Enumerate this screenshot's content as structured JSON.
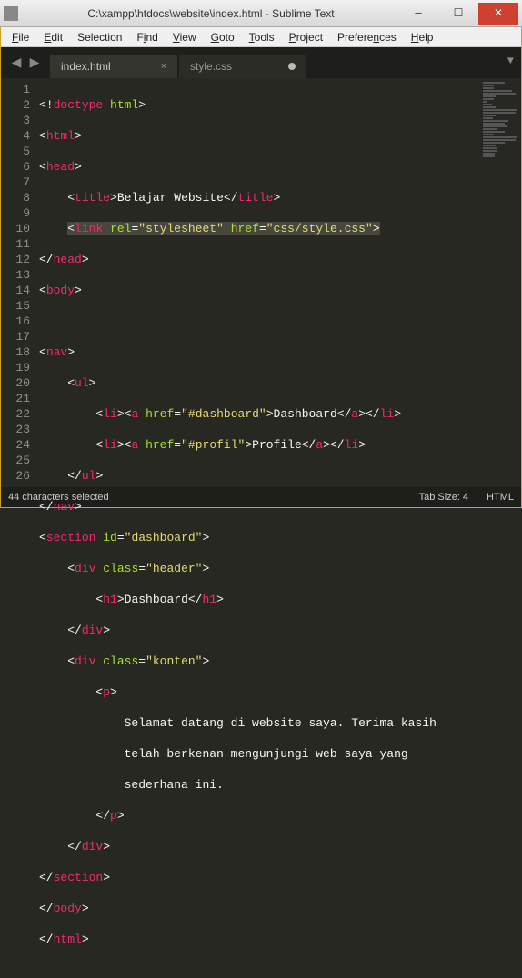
{
  "window": {
    "title": "C:\\xampp\\htdocs\\website\\index.html - Sublime Text"
  },
  "menu": {
    "file": "File",
    "edit": "Edit",
    "selection": "Selection",
    "find": "Find",
    "view": "View",
    "goto": "Goto",
    "tools": "Tools",
    "project": "Project",
    "preferences": "Preferences",
    "help": "Help"
  },
  "tabs": {
    "t0": "index.html",
    "t1": "style.css"
  },
  "gutter": {
    "l1": "1",
    "l2": "2",
    "l3": "3",
    "l4": "4",
    "l5": "5",
    "l6": "6",
    "l7": "7",
    "l8": "8",
    "l9": "9",
    "l10": "10",
    "l11": "11",
    "l12": "12",
    "l13": "13",
    "l14": "14",
    "l15": "15",
    "l16": "16",
    "l17": "17",
    "l18": "18",
    "l19": "19",
    "l20": "20",
    "l21": "21",
    "l22": "22",
    "l23": "23",
    "l24": "24",
    "l25": "25",
    "l26": "26"
  },
  "code": {
    "l1_doc": "<!",
    "l1_doc2": "doctype ",
    "l1_doc3": "html",
    "l1_doc4": ">",
    "html_open": "html",
    "head_open": "head",
    "title_open": "title",
    "title_text": "Belajar Website",
    "title_close": "title",
    "link_tag": "link",
    "link_rel_attr": "rel",
    "link_rel_val": "\"stylesheet\"",
    "link_href_attr": "href",
    "link_href_val": "\"css/style.css\"",
    "head_close": "head",
    "body_open": "body",
    "nav_open": "nav",
    "ul_open": "ul",
    "li": "li",
    "a": "a",
    "href_attr": "href",
    "href_dash": "\"#dashboard\"",
    "dash_txt": "Dashboard",
    "href_prof": "\"#profil\"",
    "prof_txt": "Profile",
    "ul_close": "ul",
    "nav_close": "nav",
    "section": "section",
    "id_attr": "id",
    "id_val": "\"dashboard\"",
    "div": "div",
    "class_attr": "class",
    "class_header": "\"header\"",
    "h1": "h1",
    "h1_txt": "Dashboard",
    "class_konten": "\"konten\"",
    "p": "p",
    "para": "Selamat datang di website saya. Terima kasih\n                telah berkenan mengunjungi web saya yang\n                sederhana ini.",
    "para_l1": "Selamat datang di website saya. Terima kasih ",
    "para_l2": "telah berkenan mengunjungi web saya yang ",
    "para_l3": "sederhana ini.",
    "section_close": "section",
    "body_close": "body",
    "html_close": "html"
  },
  "status": {
    "left": "44 characters selected",
    "tabsize": "Tab Size: 4",
    "lang": "HTML"
  }
}
